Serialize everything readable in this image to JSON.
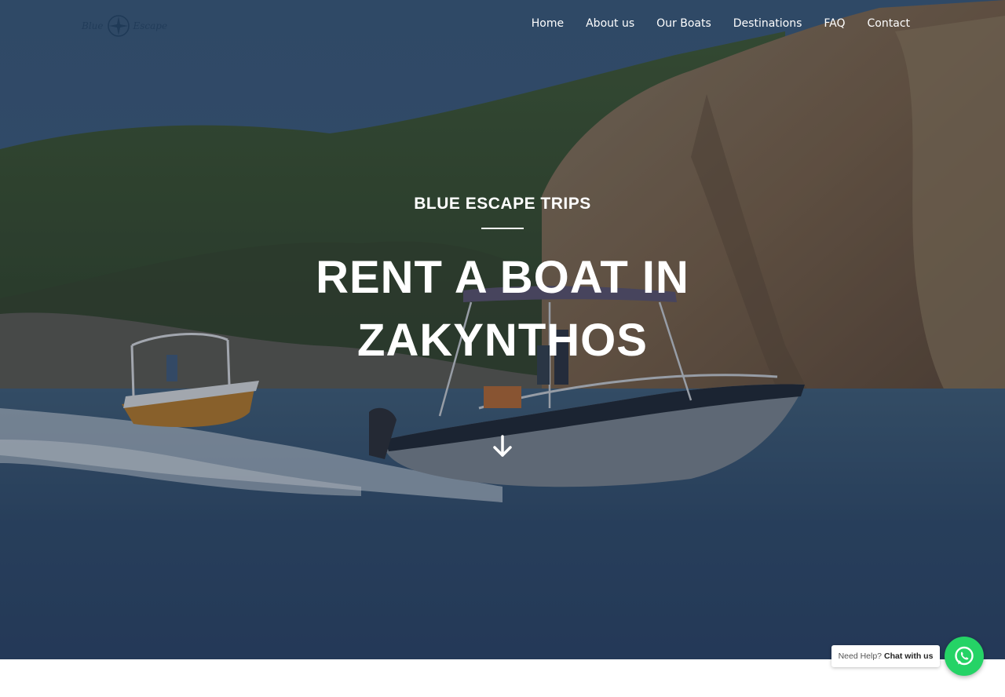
{
  "brand": {
    "logo_left": "Blue",
    "logo_right": "Escape"
  },
  "nav": {
    "items": [
      {
        "label": "Home"
      },
      {
        "label": "About us"
      },
      {
        "label": "Our Boats"
      },
      {
        "label": "Destinations"
      },
      {
        "label": "FAQ"
      },
      {
        "label": "Contact"
      }
    ]
  },
  "hero": {
    "eyebrow": "BLUE ESCAPE TRIPS",
    "title_line1": "RENT A BOAT IN",
    "title_line2": "ZAKYNTHOS",
    "scroll_icon": "arrow-down-icon"
  },
  "chat": {
    "prefix": "Need Help?",
    "action": "Chat with us",
    "icon": "whatsapp-icon",
    "color": "#25d366"
  }
}
